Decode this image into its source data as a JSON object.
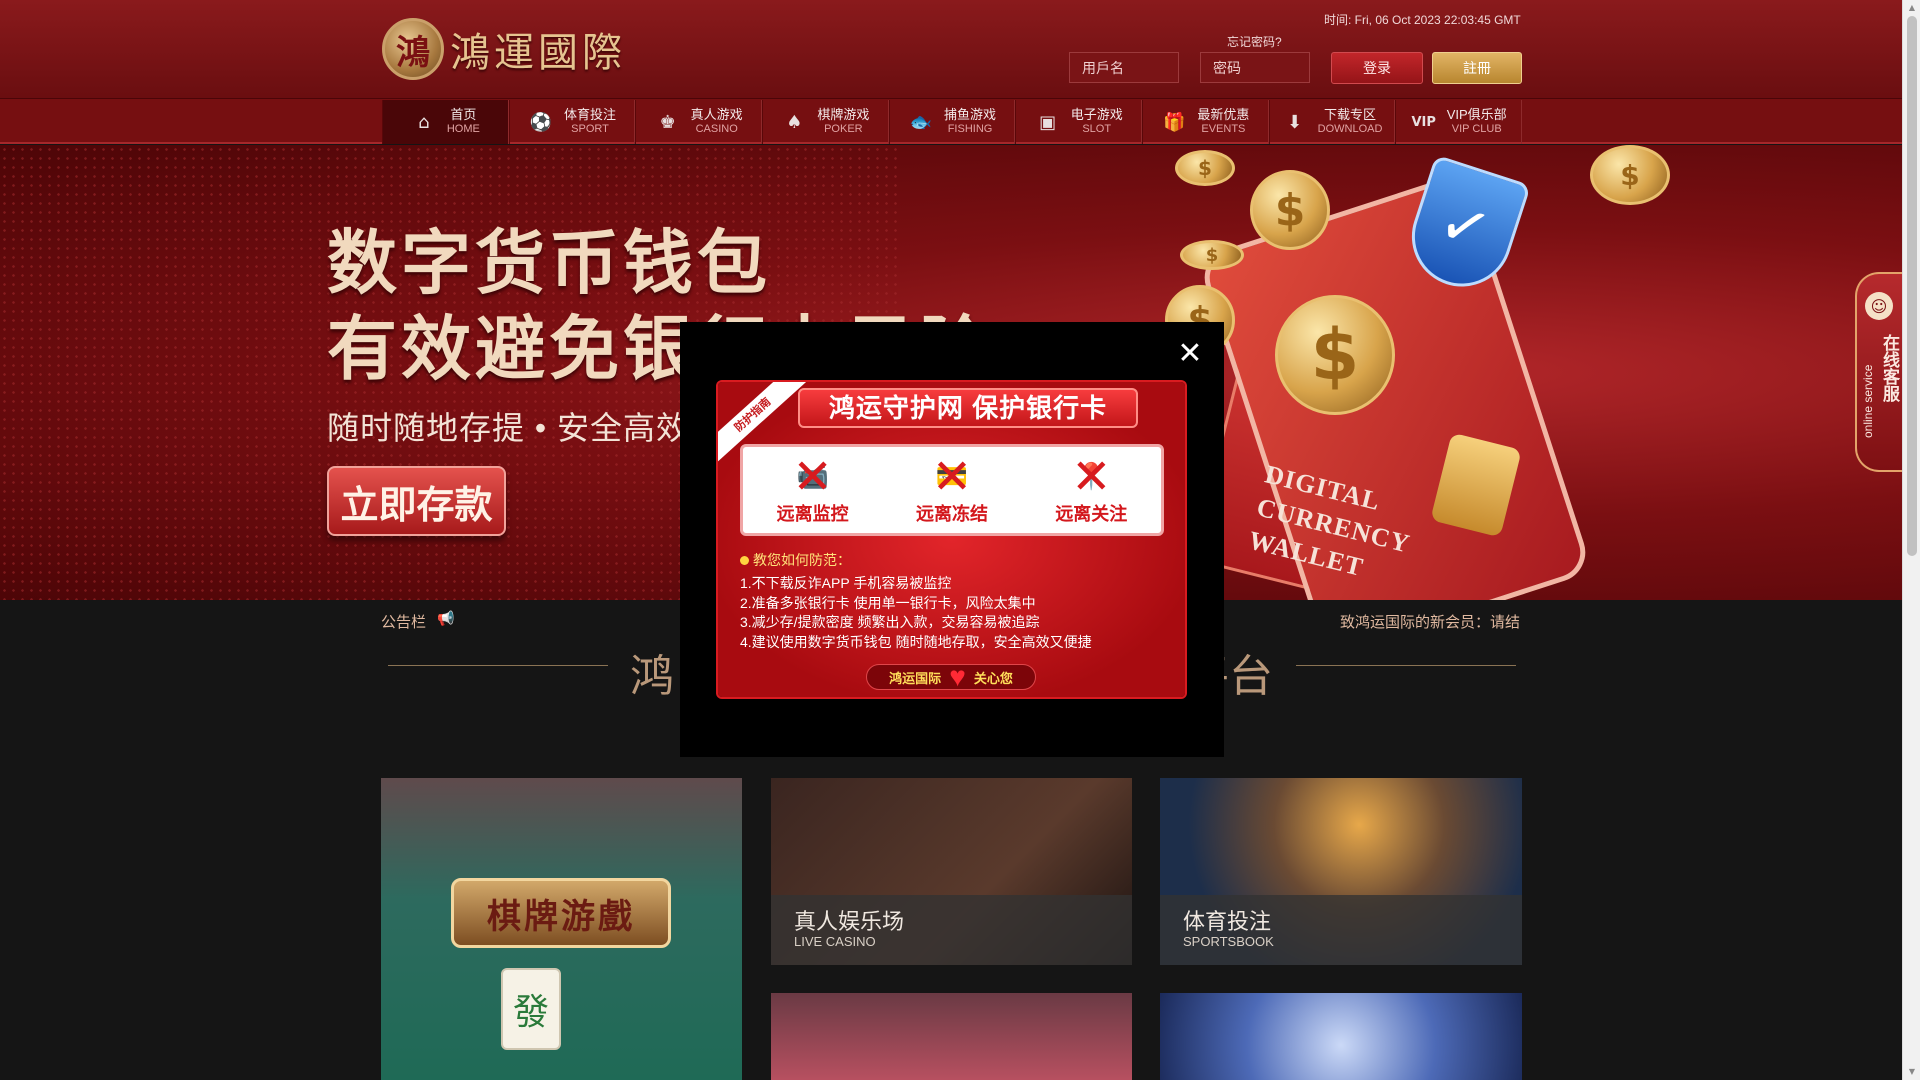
{
  "header": {
    "logo_seal": "鴻",
    "logo_text": "鴻運國際",
    "time": "时间: Fri, 06 Oct 2023 22:03:45 GMT",
    "forgot_password": "忘记密码?",
    "username_placeholder": "用戶名",
    "password_placeholder": "密码",
    "login_label": "登录",
    "register_label": "註冊"
  },
  "nav": {
    "items": [
      {
        "cn": "首页",
        "en": "HOME",
        "icon": "home-icon"
      },
      {
        "cn": "体育投注",
        "en": "SPORT",
        "icon": "sport-icon"
      },
      {
        "cn": "真人游戏",
        "en": "CASINO",
        "icon": "casino-icon"
      },
      {
        "cn": "棋牌游戏",
        "en": "POKER",
        "icon": "poker-icon"
      },
      {
        "cn": "捕鱼游戏",
        "en": "FISHING",
        "icon": "fish-icon"
      },
      {
        "cn": "电子游戏",
        "en": "SLOT",
        "icon": "slot-icon"
      },
      {
        "cn": "最新优惠",
        "en": "EVENTS",
        "icon": "gift-icon"
      },
      {
        "cn": "下载专区",
        "en": "DOWNLOAD",
        "icon": "download-icon"
      },
      {
        "cn": "VIP俱乐部",
        "en": "VIP CLUB",
        "icon": "vip-icon"
      }
    ]
  },
  "banner": {
    "title1": "数字货币钱包",
    "title2": "有效避免银行卡风险",
    "subtitle": "随时随地存提 • 安全高效",
    "deposit_button": "立即存款",
    "card_text": [
      "DIGITAL",
      "CURRENCY",
      "WALLET"
    ],
    "coin_symbol": "$",
    "shield_symbol": "✓"
  },
  "service": {
    "cn": "在线客服",
    "en": "online service",
    "avatar_glyph": "☺"
  },
  "notice": {
    "label": "公告栏",
    "text": "致鸿运国际的新会员：请结"
  },
  "section": {
    "title_left": "鸿",
    "title_right": "平台"
  },
  "tiles": {
    "poker_banner": "棋牌游戲",
    "mahjong_glyph": "發",
    "casino_cn": "真人娱乐场",
    "casino_en": "LIVE CASINO",
    "sport_cn": "体育投注",
    "sport_en": "SPORTSBOOK"
  },
  "modal": {
    "close_glyph": "✕",
    "ribbon": "防护指南",
    "head": "鸿运守护网  保护银行卡",
    "items": [
      {
        "label": "远离监控",
        "glyph": "📹"
      },
      {
        "label": "远离冻结",
        "glyph": "💳"
      },
      {
        "label": "远离关注",
        "glyph": "📍"
      }
    ],
    "tips_title": "教您如何防范：",
    "tips": [
      "1.不下载反诈APP 手机容易被监控",
      "2.准备多张银行卡 使用单一银行卡，风险太集中",
      "3.减少存/提款密度 频繁出入款，交易容易被追踪",
      "4.建议使用数字货币钱包 随时随地存取，安全高效又便捷"
    ],
    "foot_left": "鸿运国际",
    "foot_right": "关心您"
  },
  "colors": {
    "header_red": "#8a1a1c",
    "gold": "#e2b465",
    "page_bg": "#151515"
  }
}
